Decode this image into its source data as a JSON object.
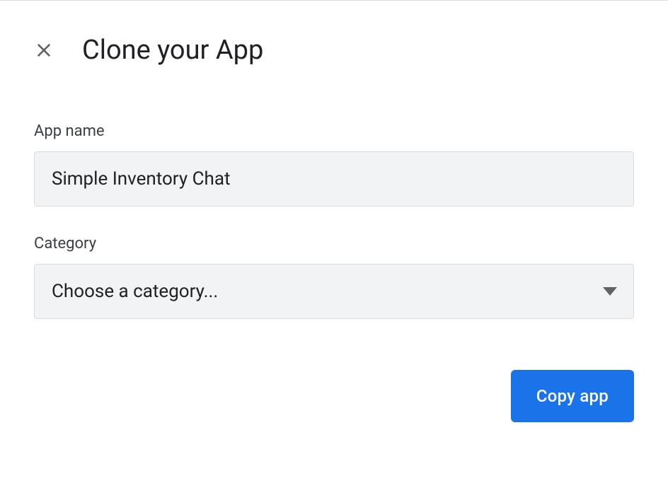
{
  "dialog": {
    "title": "Clone your App"
  },
  "fields": {
    "appName": {
      "label": "App name",
      "value": "Simple Inventory Chat"
    },
    "category": {
      "label": "Category",
      "placeholder": "Choose a category..."
    }
  },
  "actions": {
    "copy": "Copy app"
  }
}
